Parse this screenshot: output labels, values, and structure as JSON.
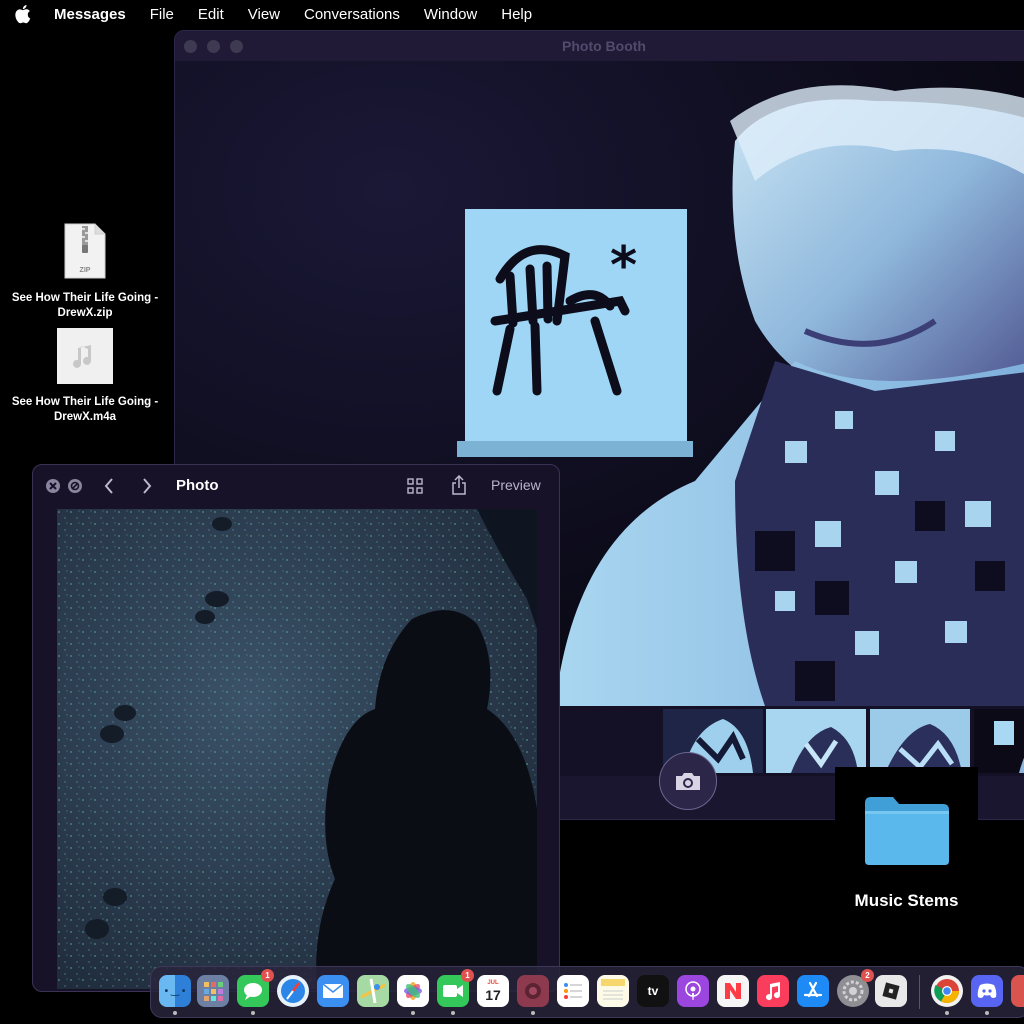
{
  "menubar": {
    "app_name": "Messages",
    "items": [
      "File",
      "Edit",
      "View",
      "Conversations",
      "Window",
      "Help"
    ],
    "apple_icon": "apple-logo-icon"
  },
  "desktop": {
    "files": [
      {
        "name": "See How Their Life Going - DrewX.zip",
        "line1": "See How Their Life Going -",
        "line2": "DrewX.zip",
        "badge": "ZIP",
        "icon": "zip-file-icon"
      },
      {
        "name": "See How Their Life Going - DrewX.m4a",
        "line1": "See How Their Life Going -",
        "line2": "DrewX.m4a",
        "icon": "audio-file-icon"
      }
    ],
    "folder": {
      "label": "Music Stems",
      "icon": "folder-icon",
      "color": "#5ab8ec"
    }
  },
  "photo_booth": {
    "title": "Photo Booth",
    "thumbnail_count": 4
  },
  "preview_window": {
    "title": "Photo",
    "app_label": "Preview"
  },
  "dock": {
    "apps": [
      {
        "name": "Finder",
        "icon": "finder-icon",
        "running": true
      },
      {
        "name": "Launchpad",
        "icon": "launchpad-icon"
      },
      {
        "name": "Messages",
        "icon": "messages-icon",
        "badge": "1",
        "running": true
      },
      {
        "name": "Safari",
        "icon": "safari-icon"
      },
      {
        "name": "Mail",
        "icon": "mail-icon"
      },
      {
        "name": "Maps",
        "icon": "maps-icon"
      },
      {
        "name": "Photos",
        "icon": "photos-icon",
        "running": true
      },
      {
        "name": "FaceTime",
        "icon": "facetime-icon",
        "badge": "1",
        "running": true
      },
      {
        "name": "Calendar",
        "icon": "calendar-icon",
        "month": "JUL",
        "day": "17"
      },
      {
        "name": "Photo Booth",
        "icon": "photo-booth-icon",
        "running": true
      },
      {
        "name": "Reminders",
        "icon": "reminders-icon"
      },
      {
        "name": "Notes",
        "icon": "notes-icon"
      },
      {
        "name": "TV",
        "icon": "apple-tv-icon",
        "label": "tv"
      },
      {
        "name": "Podcasts",
        "icon": "podcasts-icon"
      },
      {
        "name": "News",
        "icon": "news-icon"
      },
      {
        "name": "Music",
        "icon": "music-icon"
      },
      {
        "name": "App Store",
        "icon": "app-store-icon"
      },
      {
        "name": "System Settings",
        "icon": "system-settings-icon",
        "badge": "2"
      },
      {
        "name": "Roblox",
        "icon": "roblox-icon"
      },
      {
        "name": "Chrome",
        "icon": "chrome-icon",
        "running": true
      },
      {
        "name": "Discord",
        "icon": "discord-icon",
        "running": true
      },
      {
        "name": "Other",
        "icon": "app-icon"
      }
    ]
  }
}
